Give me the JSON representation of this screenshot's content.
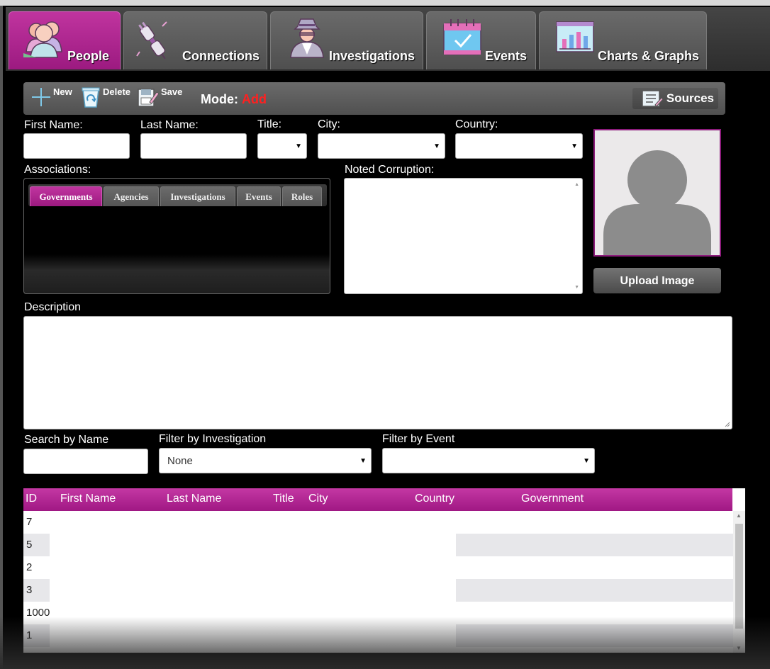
{
  "tabs": [
    {
      "label": "People",
      "icon": "people-icon",
      "active": true
    },
    {
      "label": "Connections",
      "icon": "plug-icon",
      "active": false
    },
    {
      "label": "Investigations",
      "icon": "detective-icon",
      "active": false
    },
    {
      "label": "Events",
      "icon": "calendar-icon",
      "active": false
    },
    {
      "label": "Charts & Graphs",
      "icon": "chart-icon",
      "active": false
    }
  ],
  "toolbar": {
    "new_label": "New",
    "delete_label": "Delete",
    "save_label": "Save",
    "mode_label": "Mode:",
    "mode_value": "Add",
    "sources_label": "Sources"
  },
  "form": {
    "first_name_label": "First Name:",
    "last_name_label": "Last Name:",
    "title_label": "Title:",
    "city_label": "City:",
    "country_label": "Country:",
    "first_name_value": "",
    "last_name_value": "",
    "title_value": "",
    "city_value": "",
    "country_value": "",
    "associations_label": "Associations:",
    "noted_corruption_label": "Noted Corruption:",
    "description_label": "Description",
    "upload_label": "Upload Image"
  },
  "assoc_tabs": [
    "Governments",
    "Agencies",
    "Investigations",
    "Events",
    "Roles"
  ],
  "filters": {
    "search_label": "Search by Name",
    "search_value": "",
    "investigation_label": "Filter by Investigation",
    "investigation_value": "None",
    "event_label": "Filter by Event",
    "event_value": ""
  },
  "grid": {
    "columns": [
      "ID",
      "First Name",
      "Last Name",
      "Title",
      "City",
      "Country",
      "Government"
    ],
    "rows": [
      "7",
      "5",
      "2",
      "3",
      "1000",
      "1"
    ]
  },
  "colors": {
    "accent": "#b0278f",
    "mode_value": "#ff2020"
  }
}
